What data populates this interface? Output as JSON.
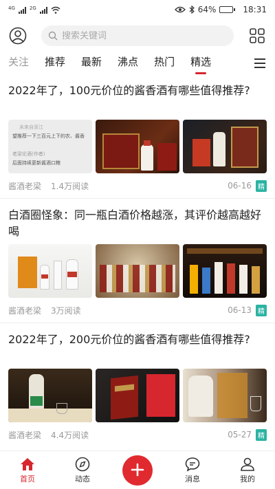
{
  "status": {
    "signal_a": "4G",
    "signal_b": "2G",
    "battery": "64%",
    "battery_level": 0.64,
    "time": "18:31"
  },
  "search": {
    "placeholder": "搜索关键词"
  },
  "tabs": [
    {
      "label": "关注",
      "state": "faded"
    },
    {
      "label": "推荐",
      "state": "normal"
    },
    {
      "label": "最新",
      "state": "normal"
    },
    {
      "label": "沸点",
      "state": "normal"
    },
    {
      "label": "热门",
      "state": "normal"
    },
    {
      "label": "精选",
      "state": "active"
    }
  ],
  "articles": [
    {
      "title": "2022年了，100元价位的酱香酒有哪些值得推荐?",
      "author": "酱酒老梁",
      "reads": "1.4万阅读",
      "date": "06-16",
      "badge": "精",
      "thumb_texts": [
        "未来自浙江",
        "望推荐一下三百元上下的农、酱香",
        "老梁论酒(作者)",
        "后面持续更新酱酒口粮"
      ]
    },
    {
      "title": "白酒圈怪象：同一瓶白酒价格越涨，其评价越高越好喝",
      "author": "酱酒老梁",
      "reads": "3万阅读",
      "date": "06-13",
      "badge": "精",
      "thumb_texts": []
    },
    {
      "title": "2022年了，200元价位的酱香酒有哪些值得推荐?",
      "author": "酱酒老梁",
      "reads": "4.4万阅读",
      "date": "05-27",
      "badge": "精",
      "thumb_texts": []
    }
  ],
  "bottom_nav": [
    {
      "label": "首页",
      "icon": "home-icon",
      "active": true
    },
    {
      "label": "动态",
      "icon": "compass-icon",
      "active": false
    },
    {
      "label": "",
      "icon": "plus-icon",
      "active": false
    },
    {
      "label": "消息",
      "icon": "chat-icon",
      "active": false
    },
    {
      "label": "我的",
      "icon": "person-icon",
      "active": false
    }
  ],
  "colors": {
    "accent": "#d6262e",
    "badge": "#2bb3a3",
    "muted": "#999999"
  }
}
